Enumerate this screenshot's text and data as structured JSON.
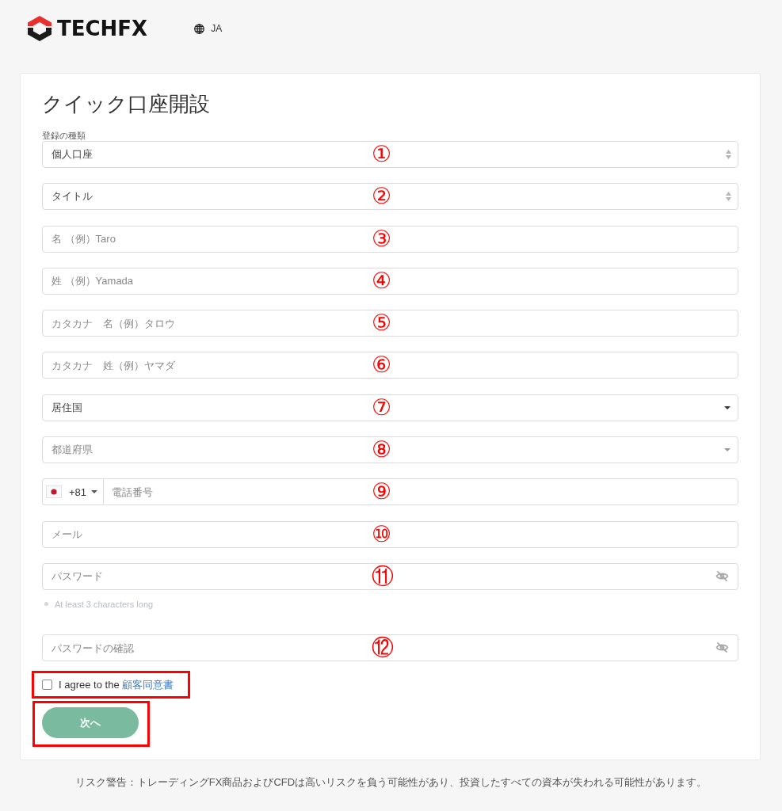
{
  "header": {
    "logo_text": "TECHFX",
    "language": "JA"
  },
  "form": {
    "title": "クイック口座開設",
    "fields": [
      {
        "kind": "select",
        "label": "登録の種類",
        "value": "個人口座",
        "callout": "①"
      },
      {
        "kind": "select",
        "value": "タイトル",
        "callout": "②"
      },
      {
        "kind": "text",
        "placeholder": "名 （例）Taro",
        "callout": "③"
      },
      {
        "kind": "text",
        "placeholder": "姓 （例）Yamada",
        "callout": "④"
      },
      {
        "kind": "text",
        "placeholder": "カタカナ　名（例）タロウ",
        "callout": "⑤"
      },
      {
        "kind": "text",
        "placeholder": "カタカナ　姓（例）ヤマダ",
        "callout": "⑥"
      },
      {
        "kind": "dropdown",
        "value": "居住国",
        "callout": "⑦"
      },
      {
        "kind": "dropdown",
        "placeholder": "都道府県",
        "callout": "⑧"
      },
      {
        "kind": "phone",
        "country_code": "+81",
        "placeholder": "電話番号",
        "callout": "⑨"
      },
      {
        "kind": "text",
        "placeholder": "メール",
        "callout": "⑩"
      },
      {
        "kind": "password",
        "placeholder": "パスワード",
        "hint": "At least 3 characters long",
        "callout": "⑪"
      },
      {
        "kind": "password",
        "placeholder": "パスワードの確認",
        "callout": "⑫"
      }
    ],
    "agreement": {
      "checked": false,
      "text": "I agree to the",
      "link": "顧客同意書",
      "highlighted": true
    },
    "submit": {
      "label": "次へ",
      "highlighted": true
    }
  },
  "footer": {
    "risk_warning": "リスク警告：トレーディングFX商品およびCFDは高いリスクを負う可能性があり、投資したすべての資本が失われる可能性があります。"
  }
}
